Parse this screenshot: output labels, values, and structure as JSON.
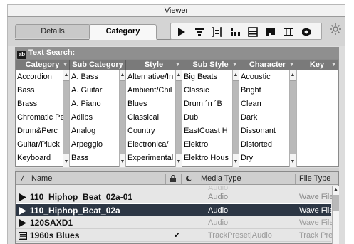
{
  "window": {
    "title": "Viewer"
  },
  "tabs": [
    {
      "label": "Details"
    },
    {
      "label": "Category"
    }
  ],
  "toolbar": {
    "icons": [
      "play-icon",
      "list-filter-icon",
      "bracket-list-icon",
      "columns-icon",
      "grid-icon",
      "layout-icon",
      "table-icon",
      "eye-icon",
      "settings-gear-icon"
    ]
  },
  "search": {
    "icon_text": "ab",
    "label": "Text Search:"
  },
  "category_table": {
    "columns": [
      {
        "label": "Category",
        "items": [
          "Accordion",
          "Bass",
          "Brass",
          "Chromatic Pe",
          "Drum&Perc",
          "Guitar/Pluck",
          "Keyboard"
        ]
      },
      {
        "label": "Sub Category",
        "items": [
          "A. Bass",
          "A. Guitar",
          "A. Piano",
          "Adlibs",
          "Analog",
          "Arpeggio",
          "Bass"
        ]
      },
      {
        "label": "Style",
        "items": [
          "Alternative/In",
          "Ambient/Chil",
          "Blues",
          "Classical",
          "Country",
          "Electronica/",
          "Experimental"
        ]
      },
      {
        "label": "Sub Style",
        "items": [
          "Big Beats",
          "Classic",
          "Drum ´n ´B",
          "Dub",
          "EastCoast H",
          "Elektro",
          "Elektro Hous"
        ]
      },
      {
        "label": "Character",
        "items": [
          "Acoustic",
          "Bright",
          "Clean",
          "Dark",
          "Dissonant",
          "Distorted",
          "Dry"
        ]
      },
      {
        "label": "Key",
        "items": []
      }
    ]
  },
  "results": {
    "headers": {
      "sort": "/",
      "name": "Name",
      "lock": "lock-icon",
      "rating": "moon-icon",
      "media_type": "Media Type",
      "file_type": "File Type"
    },
    "rows": [
      {
        "icon": "play-icon",
        "name": "110_Hiphop_Beat_02a-01",
        "media_type": "Audio",
        "file_type": "Wave File",
        "checked": "",
        "selected": false
      },
      {
        "icon": "play-icon",
        "name": "110_Hiphop_Beat_02a",
        "media_type": "Audio",
        "file_type": "Wave File",
        "checked": "",
        "selected": true
      },
      {
        "icon": "play-icon",
        "name": "120SAXD1",
        "media_type": "Audio",
        "file_type": "Wave File",
        "checked": "",
        "selected": false
      },
      {
        "icon": "trackpreset-icon",
        "name": "1960s Blues",
        "media_type": "TrackPreset|Audio",
        "file_type": "Track Prese",
        "checked": "✔",
        "selected": false
      }
    ]
  },
  "colors": {
    "selected_row": "#2c3644",
    "column_header": "#7a7a7a",
    "search_bar": "#8f8f8f"
  }
}
